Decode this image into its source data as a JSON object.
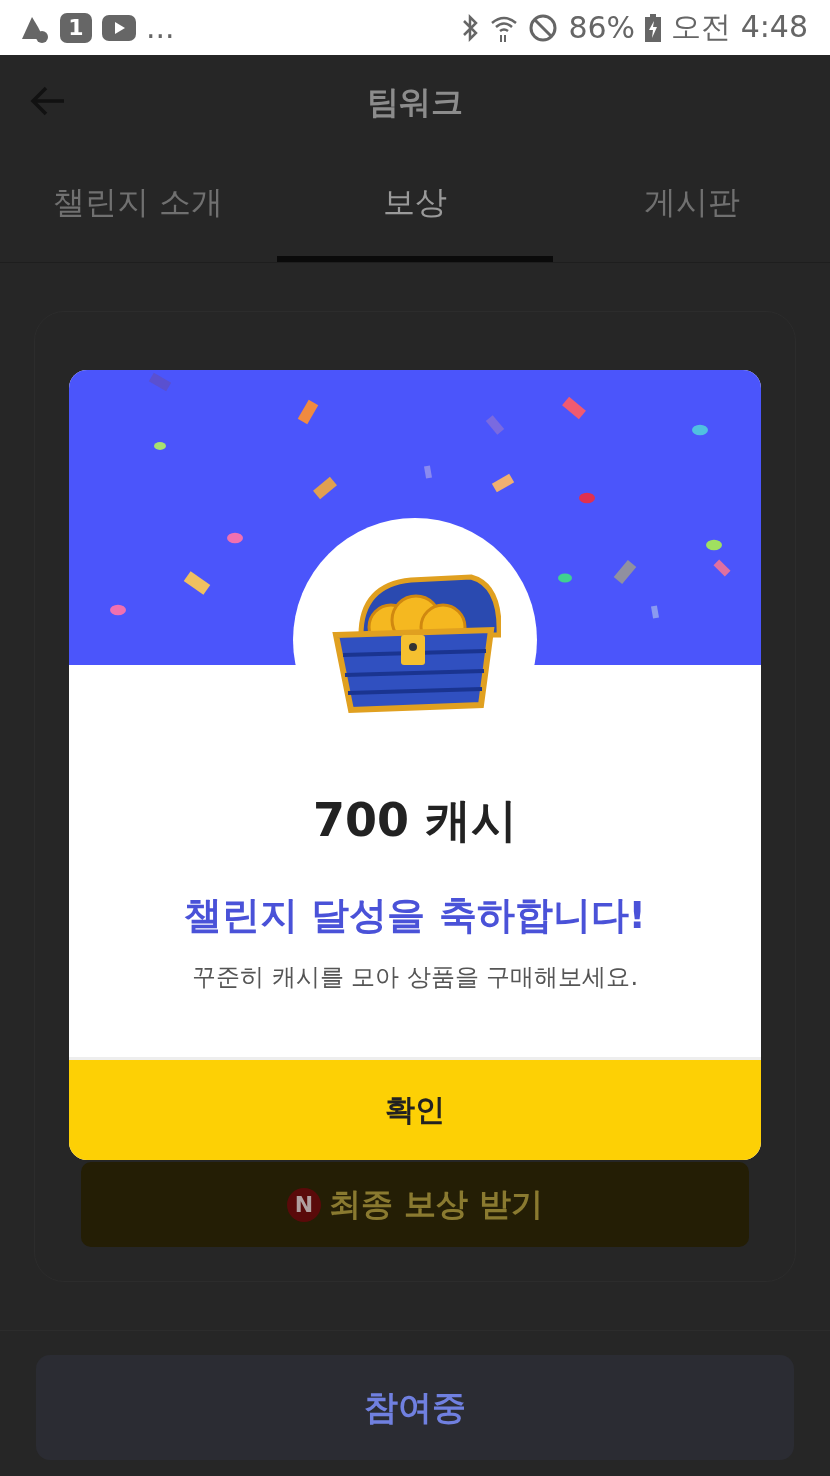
{
  "status_bar": {
    "notification_badge": "1",
    "more": "...",
    "battery": "86%",
    "time": "오전 4:48"
  },
  "app_bar": {
    "title": "팀워크"
  },
  "tabs": [
    {
      "label": "챌린지 소개",
      "selected": false
    },
    {
      "label": "보상",
      "selected": true
    },
    {
      "label": "게시판",
      "selected": false
    }
  ],
  "reward_button": {
    "badge": "N",
    "label": "최종 보상 받기"
  },
  "bottom_button": {
    "label": "참여중"
  },
  "dialog": {
    "amount": "700 캐시",
    "headline": "챌린지 달성을 축하합니다!",
    "message": "꾸준히 캐시를 모아 상품을 구매해보세요.",
    "confirm": "확인"
  }
}
